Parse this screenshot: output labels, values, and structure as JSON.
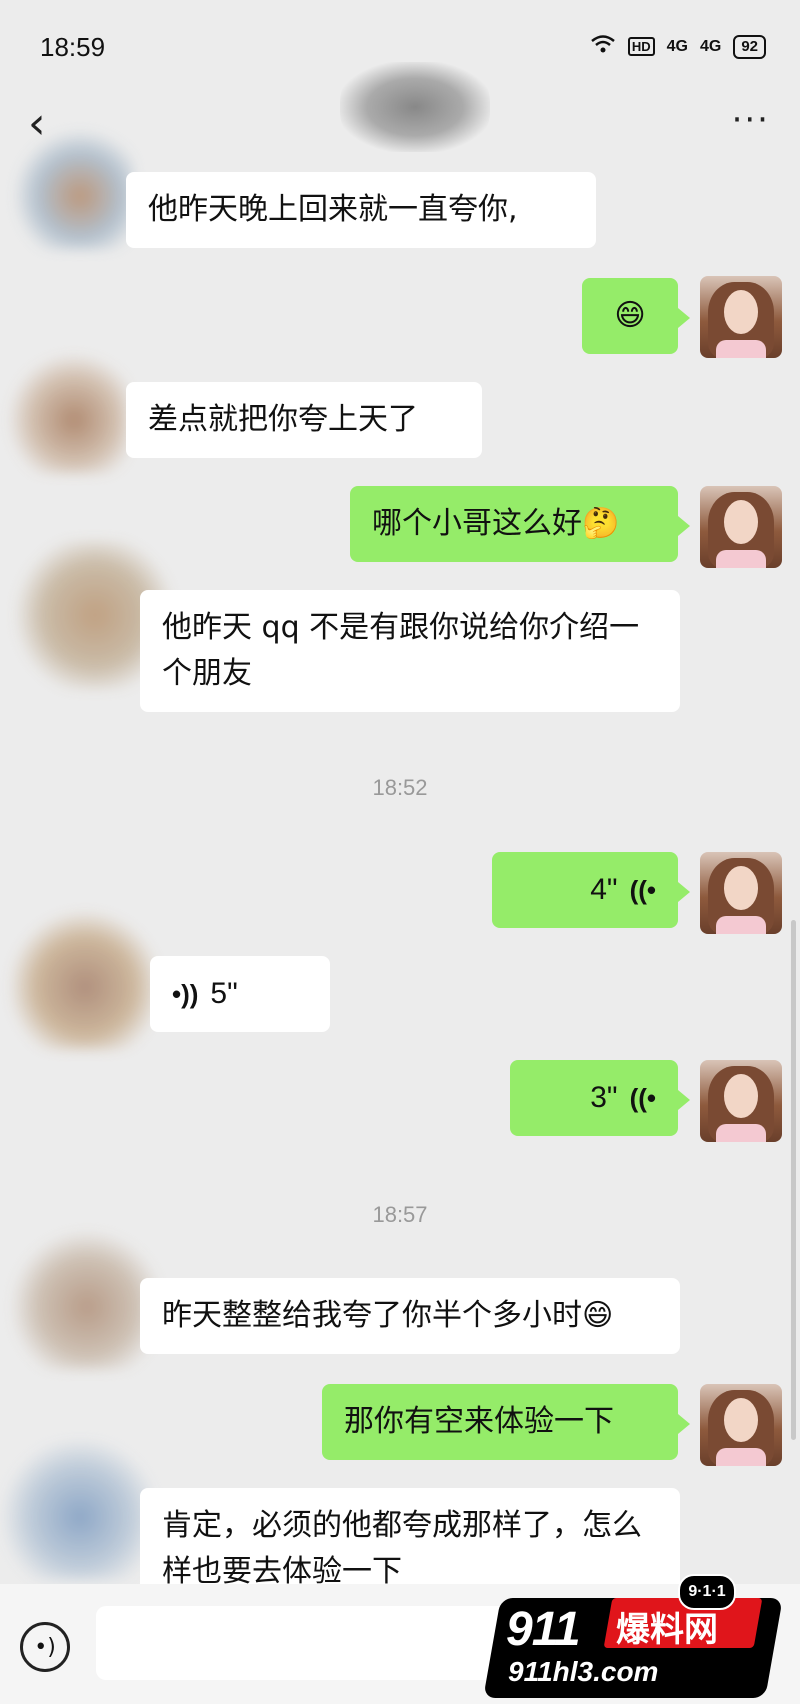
{
  "status_bar": {
    "time": "18:59",
    "signal": "4G",
    "battery": "92",
    "hd": "HD"
  },
  "nav": {
    "back_icon": "‹",
    "more_icon": "···"
  },
  "messages": [
    {
      "id": "m1",
      "side": "in",
      "text": "他昨天晚上回来就一直夸你,"
    },
    {
      "id": "m2",
      "side": "out",
      "text": "😄"
    },
    {
      "id": "m3",
      "side": "in",
      "text": "差点就把你夸上天了"
    },
    {
      "id": "m4",
      "side": "out",
      "text": "哪个小哥这么好🤔"
    },
    {
      "id": "m5",
      "side": "in",
      "text": "他昨天 qq 不是有跟你说给你介绍一个朋友"
    },
    {
      "id": "m6",
      "side": "out",
      "type": "voice",
      "text": "4\""
    },
    {
      "id": "m7",
      "side": "in",
      "type": "voice",
      "text": "5\""
    },
    {
      "id": "m8",
      "side": "out",
      "type": "voice",
      "text": "3\""
    },
    {
      "id": "m9",
      "side": "in",
      "text": "昨天整整给我夸了你半个多小时😄"
    },
    {
      "id": "m10",
      "side": "out",
      "text": "那你有空来体验一下"
    },
    {
      "id": "m11",
      "side": "in",
      "text": "肯定，必须的他都夸成那样了，怎么样也要去体验一下"
    }
  ],
  "timestamps": {
    "t1": "18:52",
    "t2": "18:57"
  },
  "watermark": {
    "tag": "9·1·1",
    "brand": "911",
    "name": "爆料网",
    "url": "911hl3.com"
  },
  "colors": {
    "incoming": "#ffffff",
    "outgoing": "#95ec69",
    "background": "#ececec"
  }
}
